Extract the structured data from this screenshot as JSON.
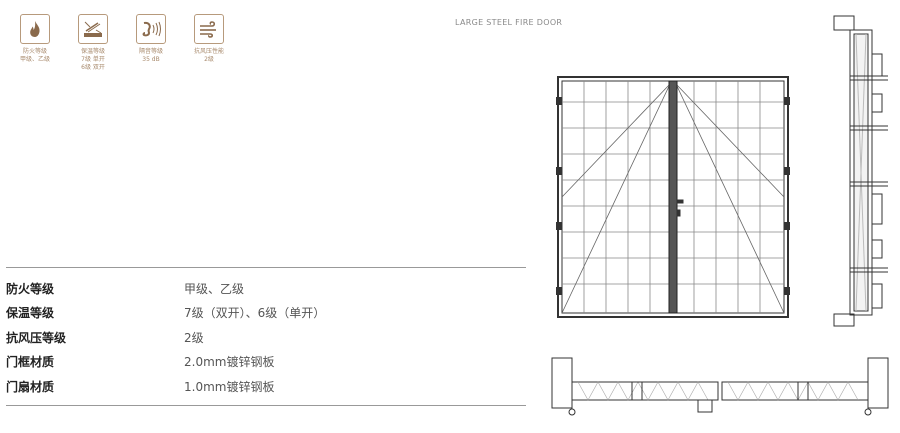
{
  "features": [
    {
      "icon": "flame-icon",
      "lines": [
        "防火等级",
        "甲级、乙级"
      ]
    },
    {
      "icon": "insulation-icon",
      "lines": [
        "保温等级",
        "7级 单开",
        "6级 双开"
      ]
    },
    {
      "icon": "sound-wave-icon",
      "lines": [
        "隔音等级",
        "35 dB"
      ]
    },
    {
      "icon": "wind-icon",
      "lines": [
        "抗风压性能",
        "2级"
      ]
    }
  ],
  "product_title": "LARGE STEEL FIRE DOOR",
  "specs": [
    {
      "label": "防火等级",
      "value": "甲级、乙级"
    },
    {
      "label": "保温等级",
      "value": "7级（双开）、6级（单开）"
    },
    {
      "label": "抗风压等级",
      "value": "2级"
    },
    {
      "label": "门框材质",
      "value": "2.0mm镀锌钢板"
    },
    {
      "label": "门扇材质",
      "value": "1.0mm镀锌钢板"
    }
  ],
  "colors": {
    "accent": "#b79a7c",
    "icon_fill": "#8a6a4c",
    "rule": "#999999",
    "line": "#333333"
  }
}
